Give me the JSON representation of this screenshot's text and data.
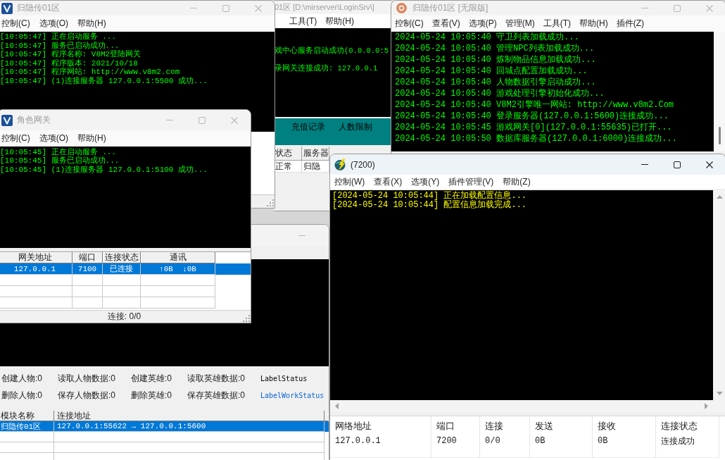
{
  "windows": [
    {
      "title": "归隐传01区",
      "active": false,
      "menu": [
        "控制(C)",
        "选项(O)",
        "帮助(H)"
      ],
      "log": [
        "[10:05:47] 正在启动服务 ...",
        "[10:05:47] 服务已启动成功...",
        "[10:05:47] 程序名称: V8M2登陆网关",
        "[10:05:47] 程序版本: 2021/10/18",
        "[10:05:47] 程序网站: http://www.v8m2.com",
        "[10:05:47] (1)连接服务器 127.0.0.1:5500 成功..."
      ]
    },
    {
      "title": "01区 [D:\\mirserver\\LoginSrv\\]",
      "active": false,
      "menu": [
        "工具(T)",
        "帮助(H)"
      ],
      "log": [
        "戏中心服务启动成功(0.0.0.0:5",
        "录网关连接成功: 127.0.0.1"
      ],
      "toolbar": [
        "充值记录",
        "人数限制"
      ],
      "table": {
        "columns": [
          "状态",
          "服务器"
        ],
        "rows": [
          {
            "cells": [
              "正常",
              "归隐"
            ],
            "selected": false
          }
        ]
      }
    },
    {
      "title": "归隐传01区 [无限版]",
      "active": false,
      "menu": [
        "控制(C)",
        "查看(V)",
        "选项(P)",
        "管理(M)",
        "工具(T)",
        "帮助(H)",
        "插件(Z)"
      ],
      "log": [
        "2024-05-24 10:05:40 守卫列表加载成功...",
        "2024-05-24 10:05:40 管理NPC列表加载成功...",
        "2024-05-24 10:05:40 炼制物品信息加载成功...",
        "2024-05-24 10:05:40 回城点配置加载成功...",
        "2024-05-24 10:05:40 人物数据引擎启动成功...",
        "2024-05-24 10:05:40 游戏处理引擎初始化成功...",
        "2024-05-24 10:05:40 V8M2引擎唯一网站: http://www.v8m2.Com",
        "2024-05-24 10:05:40 登录服务器(127.0.0.1:5600)连接成功...",
        "2024-05-24 10:05:45 游戏网关[0](127.0.0.1:55635)已打开...",
        "2024-05-24 10:05:50 数据库服务器(127.0.0.1:6000)连接成功..."
      ]
    },
    {
      "title": "角色网关",
      "active": false,
      "menu": [
        "控制(C)",
        "选项(O)",
        "帮助(H)"
      ],
      "log": [
        "[10:05:45] 正在启动服务 ...",
        "[10:05:45] 服务已启动成功...",
        "[10:05:45] (1)连接服务器 127.0.0.1:5100 成功..."
      ],
      "table": {
        "columns": [
          "网关地址",
          "端口",
          "连接状态",
          "通讯"
        ],
        "rows": [
          {
            "cells": [
              "127.0.0.1",
              "7100",
              "已连接",
              "↑0B  ↓0B"
            ],
            "selected": true
          }
        ]
      },
      "status_bar": "连接: 0/0"
    },
    {
      "active": false,
      "counters": [
        "创建人物:0",
        "读取人物数据:0",
        "创建英雄:0",
        "读取英雄数据:0",
        "删除人物:0",
        "保存人物数据:0",
        "删除英雄:0",
        "保存英雄数据:0"
      ],
      "labels": [
        {
          "text": "LabelStatus",
          "color": "#000000"
        },
        {
          "text": "LabelWorkStatus",
          "color": "#0a64d2"
        }
      ],
      "table": {
        "columns": [
          "模块名称",
          "连接地址"
        ],
        "rows": [
          {
            "cells": [
              "归隐传01区",
              "127.0.0.1:55622 → 127.0.0.1:5600"
            ],
            "selected": true
          }
        ]
      }
    },
    {
      "title": "(7200)",
      "active": true,
      "menu": [
        "控制(W)",
        "查看(X)",
        "选项(Y)",
        "插件管理(V)",
        "帮助(Z)"
      ],
      "log": [
        "[2024-05-24 10:05:44] 正在加载配置信息...",
        "[2024-05-24 10:05:44] 配置信息加载完成..."
      ],
      "table": {
        "columns": [
          "网络地址",
          "端口",
          "连接",
          "发送",
          "接收",
          "连接状态"
        ],
        "rows": [
          {
            "cells": [
              "127.0.0.1",
              "7200",
              "0/0",
              "0B",
              "0B",
              "连接成功"
            ],
            "selected": false
          }
        ]
      }
    }
  ]
}
